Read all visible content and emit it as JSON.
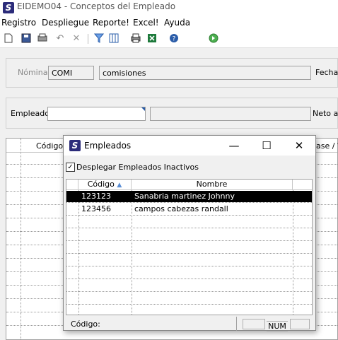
{
  "window": {
    "app_icon_letter": "S",
    "title": "EIDEMO04 - Conceptos del Empleado"
  },
  "menu": [
    "Registro",
    "Despliegue",
    "Reporte!",
    "Excel!",
    "Ayuda"
  ],
  "toolbar": {
    "icons": [
      "new-document-icon",
      "save-icon",
      "print-preview-icon",
      "undo-icon",
      "delete-icon",
      "filter-icon",
      "columns-icon",
      "print-icon",
      "excel-icon",
      "help-icon",
      "go-icon"
    ]
  },
  "form": {
    "nomina_label": "Nómina:",
    "nomina_code": "COMI",
    "nomina_desc": "comisiones",
    "fecha_label": "Fecha",
    "empleado_label": "Empleado:",
    "empleado_value": "",
    "empleado_name": "",
    "neto_label": "Neto a l"
  },
  "bg_grid": {
    "col_codigo": "Código",
    "col_right": "ase / W"
  },
  "dialog": {
    "app_icon_letter": "S",
    "title": "Empleados",
    "checkbox_label": "Desplegar Empleados Inactivos",
    "checkbox_checked": true,
    "columns": [
      "Código",
      "Nombre"
    ],
    "rows": [
      {
        "codigo": "123123",
        "nombre": "Sanabria martinez Johnny",
        "selected": true
      },
      {
        "codigo": "123456",
        "nombre": "campos  cabezas randall",
        "selected": false
      }
    ],
    "status_label": "Código:",
    "status_num": "NUM"
  }
}
